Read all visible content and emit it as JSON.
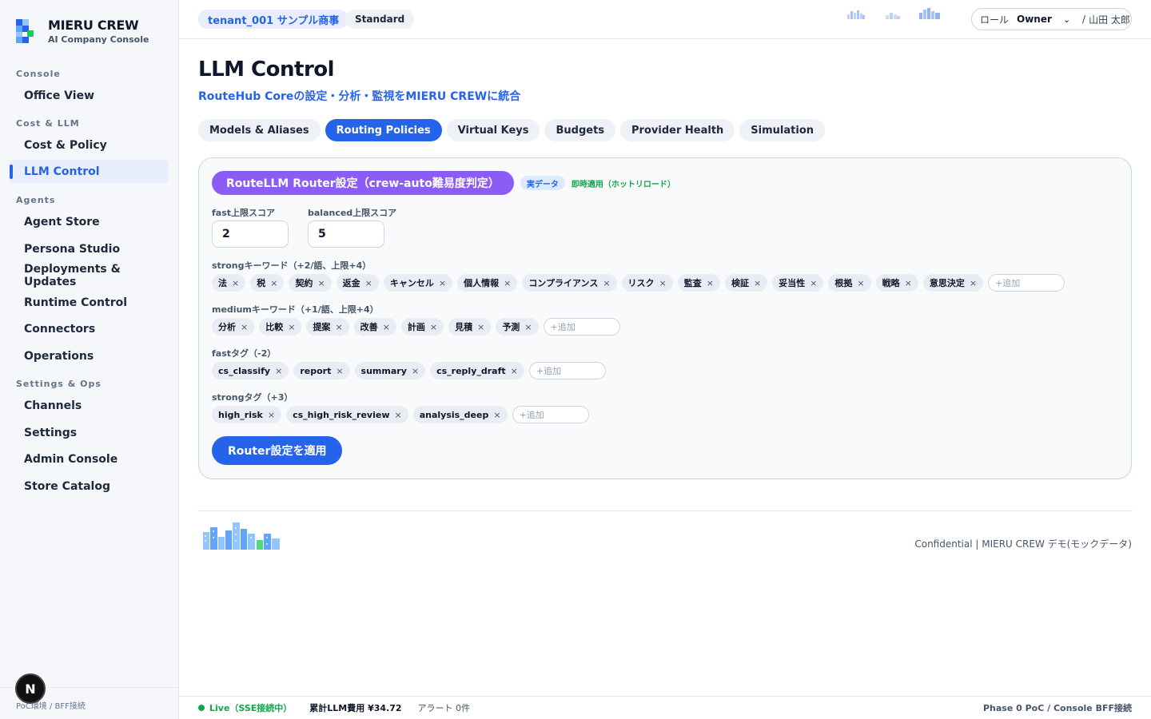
{
  "brand": {
    "title": "MIERU CREW",
    "subtitle": "AI Company Console"
  },
  "sidebar": {
    "groups": [
      {
        "label": "Console",
        "items": [
          {
            "label": "Office View"
          }
        ]
      },
      {
        "label": "Cost & LLM",
        "items": [
          {
            "label": "Cost & Policy"
          },
          {
            "label": "LLM Control",
            "active": true
          }
        ]
      },
      {
        "label": "Agents",
        "items": [
          {
            "label": "Agent Store"
          },
          {
            "label": "Persona Studio"
          },
          {
            "label": "Deployments & Updates"
          },
          {
            "label": "Runtime Control"
          },
          {
            "label": "Connectors"
          },
          {
            "label": "Operations"
          }
        ]
      },
      {
        "label": "Settings & Ops",
        "items": [
          {
            "label": "Channels"
          },
          {
            "label": "Settings"
          },
          {
            "label": "Admin Console"
          },
          {
            "label": "Store Catalog"
          }
        ]
      }
    ],
    "footer": "PoC環境 / BFF接続",
    "dev_badge": "N"
  },
  "header": {
    "tenant": "tenant_001 サンプル商事",
    "plan": "Standard",
    "role_label": "ロール",
    "role_value": "Owner",
    "separator": "/",
    "user": "山田 太郎"
  },
  "main": {
    "title": "LLM Control",
    "subtitle": "RouteHub Coreの設定・分析・監視をMIERU CREWに統合",
    "tabs": [
      {
        "label": "Models & Aliases"
      },
      {
        "label": "Routing Policies",
        "active": true
      },
      {
        "label": "Virtual Keys"
      },
      {
        "label": "Budgets"
      },
      {
        "label": "Provider Health"
      },
      {
        "label": "Simulation"
      }
    ]
  },
  "router": {
    "title": "RouteLLM Router設定（crew-auto難易度判定）",
    "badge_real": "実データ",
    "badge_hot": "即時適用（ホットリロード）",
    "fast_label": "fast上限スコア",
    "fast_value": "2",
    "balanced_label": "balanced上限スコア",
    "balanced_value": "5",
    "strong_kw_label": "strongキーワード（+2/語、上限+4）",
    "strong_kw": [
      "法",
      "税",
      "契約",
      "返金",
      "キャンセル",
      "個人情報",
      "コンプライアンス",
      "リスク",
      "監査",
      "検証",
      "妥当性",
      "根拠",
      "戦略",
      "意思決定"
    ],
    "medium_kw_label": "mediumキーワード（+1/語、上限+4）",
    "medium_kw": [
      "分析",
      "比較",
      "提案",
      "改善",
      "計画",
      "見積",
      "予測"
    ],
    "fast_tag_label": "fastタグ（-2）",
    "fast_tags": [
      "cs_classify",
      "report",
      "summary",
      "cs_reply_draft"
    ],
    "strong_tag_label": "strongタグ（+3）",
    "strong_tags": [
      "high_risk",
      "cs_high_risk_review",
      "analysis_deep"
    ],
    "add_placeholder": "+追加",
    "remove_glyph": "×",
    "apply_label": "Router設定を適用"
  },
  "footer": {
    "confidential": "Confidential | MIERU CREW デモ(モックデータ)"
  },
  "statusbar": {
    "live": "Live（SSE接続中）",
    "cost": "累計LLM費用 ¥34.72",
    "alert": "アラート 0件",
    "phase": "Phase 0 PoC / Console BFF接続"
  },
  "colors": {
    "accent": "#2563eb",
    "purple": "#8b5cf6",
    "live": "#16a34a"
  }
}
